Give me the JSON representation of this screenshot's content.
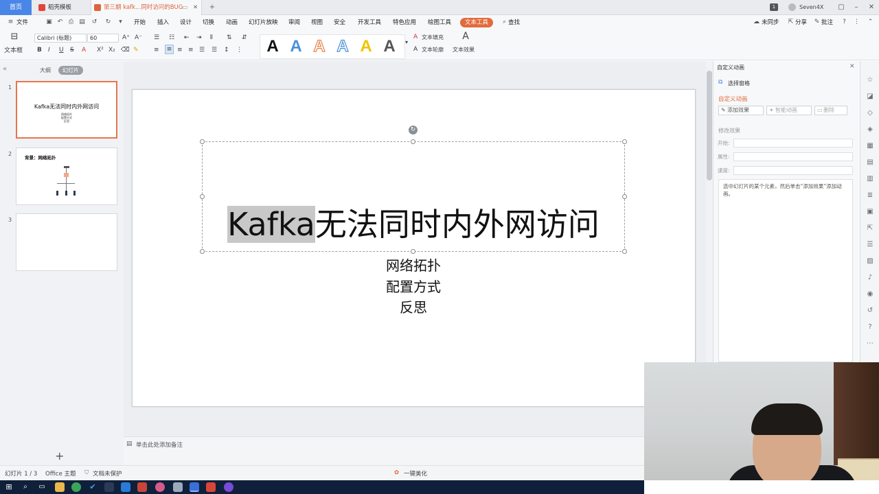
{
  "tabs": {
    "home": "首页",
    "template": "稻壳模板",
    "document": "第三期 kafk...同时访问的BUG",
    "user": "Seven4X",
    "badge": "1"
  },
  "menu": {
    "file": "文件",
    "items": [
      "开始",
      "插入",
      "设计",
      "切换",
      "动画",
      "幻灯片放映",
      "审阅",
      "视图",
      "安全",
      "开发工具",
      "特色应用",
      "绘图工具"
    ],
    "active": "文本工具",
    "search": "查找",
    "sync": "未同步",
    "share": "分享",
    "comment": "批注"
  },
  "ribbon": {
    "textbox": "文本框",
    "font_name": "Calibri (标题)",
    "font_size": "60",
    "text_fill": "文本填充",
    "text_outline": "文本轮廓",
    "text_effect": "文本效果",
    "wordart_letter": "A",
    "wordart_colors": [
      "#111111",
      "#4a90d9",
      "#e8834a",
      "#4a90d9",
      "#f2c200",
      "#555555"
    ]
  },
  "left_panel": {
    "outline": "大纲",
    "slides": "幻灯片",
    "thumb1_title": "Kafka无法同时内外网访问",
    "thumb1_lines": [
      "网络拓扑",
      "配置方式",
      "反思"
    ],
    "thumb2_title": "背景：网络拓扑",
    "slide_numbers": [
      "1",
      "2",
      "3"
    ]
  },
  "slide": {
    "title_highlight": "Kafka",
    "title_rest": "无法同时内外网访问",
    "subtitle": [
      "网络拓扑",
      "配置方式",
      "反思"
    ]
  },
  "notes": {
    "placeholder": "单击此处添加备注"
  },
  "right_panel": {
    "header": "自定义动画",
    "select_pane": "选择窗格",
    "section_title": "自定义动画",
    "add_effect": "添加效果",
    "smart_anim": "智能动画",
    "delete": "删除",
    "modify": "修改效果",
    "start_label": "开始:",
    "property_label": "属性:",
    "speed_label": "速度:",
    "hint": "选中幻灯片的某个元素，然后单击“添加效果”添加动画。"
  },
  "status": {
    "slide_count": "幻灯片 1 / 3",
    "theme": "Office 主题",
    "protect": "文档未保护",
    "beautify": "一键美化"
  },
  "colors": {
    "accent": "#e26b3c",
    "home_tab": "#4a86e8",
    "taskbar": "#10203a"
  }
}
